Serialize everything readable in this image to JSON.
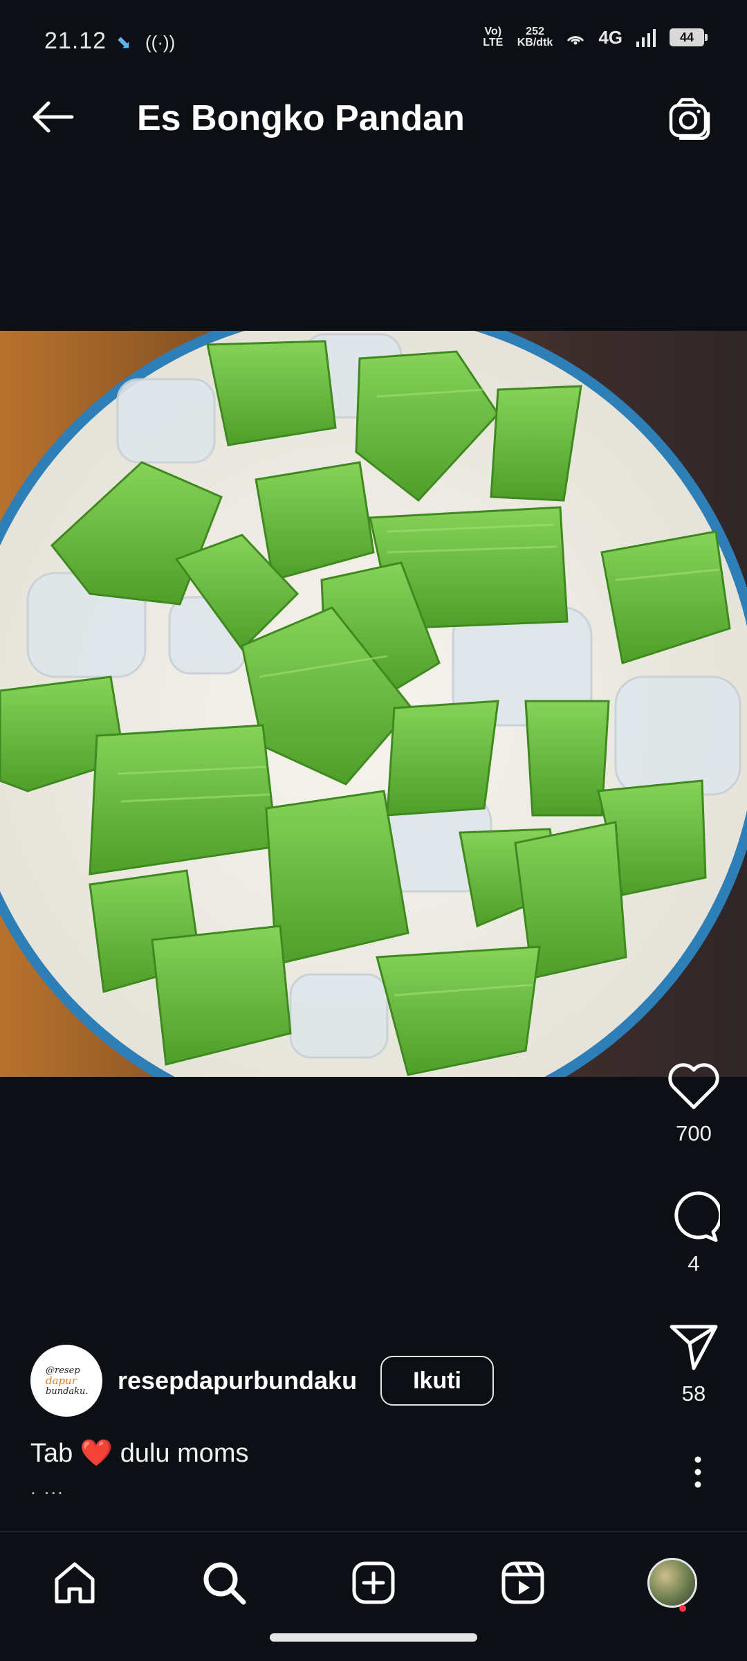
{
  "status_bar": {
    "time": "21.12",
    "volte": "Vo) LTE",
    "speed_value": "252",
    "speed_unit": "KB/dtk",
    "network": "4G",
    "battery": "44"
  },
  "header": {
    "title": "Es Bongko Pandan",
    "back_icon": "arrow-left-icon",
    "camera_icon": "camera-icon"
  },
  "actions": {
    "likes": "700",
    "comments": "4",
    "shares": "58"
  },
  "author": {
    "username": "resepdapurbundaku",
    "follow_label": "Ikuti",
    "avatar_line1": "@resep",
    "avatar_line2": "dapur",
    "avatar_line3": "bundaku."
  },
  "caption": {
    "text": "Tab ❤️ dulu moms",
    "more": ". ..."
  },
  "bottom_nav": {
    "items": [
      "home-icon",
      "search-icon",
      "create-icon",
      "reels-icon",
      "profile-avatar"
    ]
  },
  "colors": {
    "background": "#0c0f14",
    "notification_dot": "#ff3040",
    "pandan_green": "#6cc43a",
    "coconut_milk": "#f1efe8",
    "bowl_rim": "#2e7fb8"
  }
}
